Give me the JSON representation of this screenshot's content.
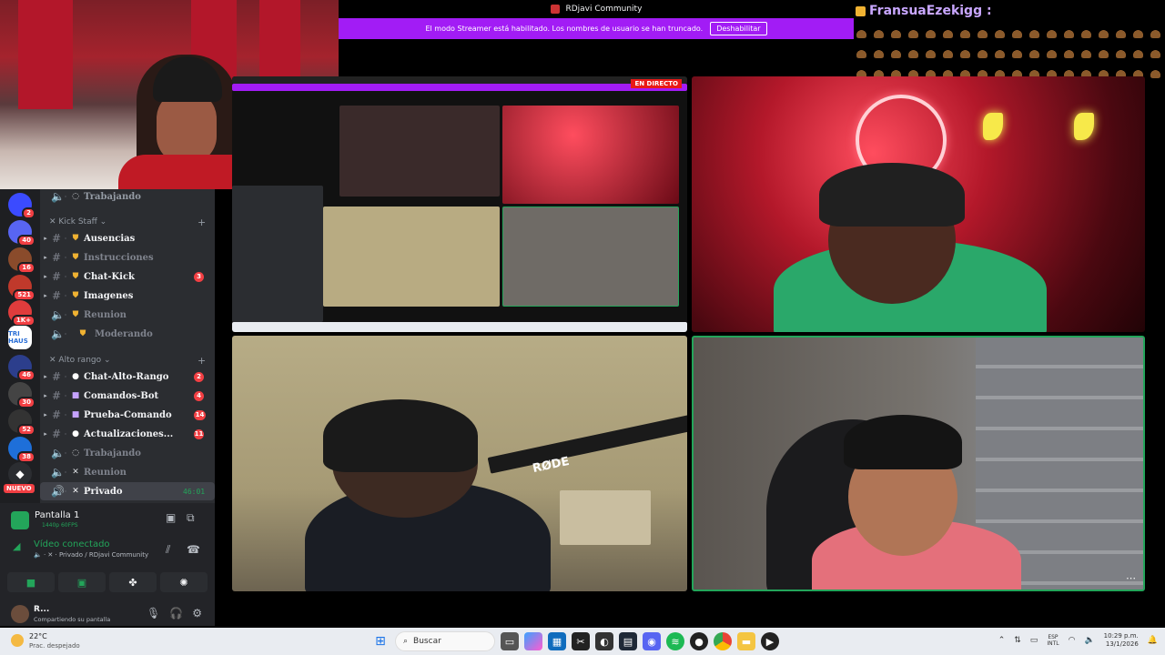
{
  "window": {
    "title": "RDjavi Community"
  },
  "streamer_bar": {
    "message": "El modo Streamer está habilitado. Los nombres de usuario se han truncado.",
    "button": "Deshabilitar"
  },
  "chat_overlay": {
    "username": "FransuaEzekigg :"
  },
  "nested_view": {
    "live_badge": "EN DIRECTO"
  },
  "guilds": [
    {
      "label": "",
      "color": "#3b4bff",
      "badge": "2"
    },
    {
      "label": "",
      "color": "#5865f2",
      "badge": "40"
    },
    {
      "label": "",
      "color": "#8a4b2b",
      "badge": "16"
    },
    {
      "label": "",
      "color": "#c0392b",
      "badge": "521"
    },
    {
      "label": "",
      "color": "#e03c3c",
      "badge": "1K+"
    },
    {
      "label": "TRI HAUS",
      "color": "#ffffff",
      "badge": ""
    },
    {
      "label": "",
      "color": "#2c3e8c",
      "badge": "46"
    },
    {
      "label": "",
      "color": "#444",
      "badge": "30"
    },
    {
      "label": "",
      "color": "#333",
      "badge": "52"
    },
    {
      "label": "",
      "color": "#1e6fd9",
      "badge": "38"
    },
    {
      "label": "",
      "color": "#2b2d31",
      "badge": ""
    }
  ],
  "new_label": "NUEVO",
  "channels": {
    "top_item": "Trabajando",
    "category_1": "Kick Staff",
    "items_1": [
      {
        "name": "Ausencias",
        "badge": ""
      },
      {
        "name": "Instrucciones",
        "badge": ""
      },
      {
        "name": "Chat-Kick",
        "badge": "3"
      },
      {
        "name": "Imagenes",
        "badge": ""
      },
      {
        "name": "Reunion",
        "badge": ""
      },
      {
        "name": "Moderando",
        "badge": ""
      }
    ],
    "category_2": "Alto rango",
    "items_2": [
      {
        "name": "Chat-Alto-Rango",
        "badge": "2"
      },
      {
        "name": "Comandos-Bot",
        "badge": "4"
      },
      {
        "name": "Prueba-Comando",
        "badge": "14"
      },
      {
        "name": "Actualizaciones...",
        "badge": "11"
      },
      {
        "name": "Trabajando",
        "badge": ""
      },
      {
        "name": "Reunion",
        "badge": ""
      },
      {
        "name": "Privado",
        "badge": "",
        "time": "46:01"
      }
    ]
  },
  "voice_panel": {
    "screen_title": "Pantalla 1",
    "screen_sub": "1440p 60FPS",
    "connected": "Vídeo conectado",
    "location": "Privado / RDjavi Community",
    "user_name": "R...",
    "user_status": "Compartiendo su pantalla"
  },
  "taskbar": {
    "weather_temp": "22°C",
    "weather_desc": "Prac. despejado",
    "search": "Buscar",
    "lang_1": "ESP",
    "lang_2": "INTL",
    "time": "10:29 p.m.",
    "date": "13/1/2026"
  },
  "colors": {
    "accent": "#a21cf5",
    "discord_green": "#23a55a",
    "badge_red": "#f23f43"
  }
}
